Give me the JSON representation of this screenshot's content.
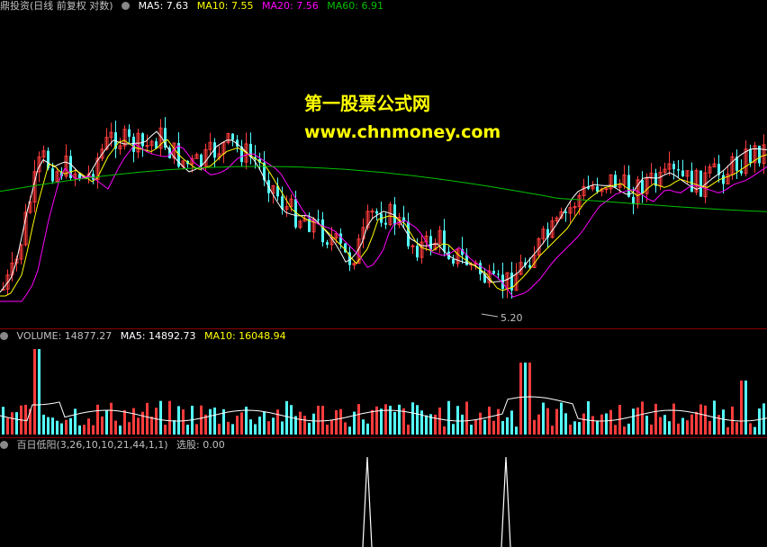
{
  "main_legend": {
    "title": "鼎投资(日线 前复权 对数)",
    "ma5": "MA5: 7.63",
    "ma10": "MA10: 7.55",
    "ma20": "MA20: 7.56",
    "ma60": "MA60: 6.91"
  },
  "low_label": "5.20",
  "watermark": {
    "line1": "第一股票公式网",
    "line2": "www.chnmoney.com"
  },
  "volume_legend": {
    "volume": "VOLUME: 14877.27",
    "ma5": "MA5: 14892.73",
    "ma10": "MA10: 16048.94"
  },
  "indicator_legend": {
    "name": "百日低阳(3,26,10,10,21,44,1,1)",
    "value": "选股: 0.00"
  },
  "colors": {
    "up": "#ff3c3c",
    "down": "#54ffff",
    "ma5": "#ffffff",
    "ma10": "#ffff00",
    "ma20": "#ff00ff",
    "ma60": "#00c000",
    "separator": "#8b0000"
  }
}
